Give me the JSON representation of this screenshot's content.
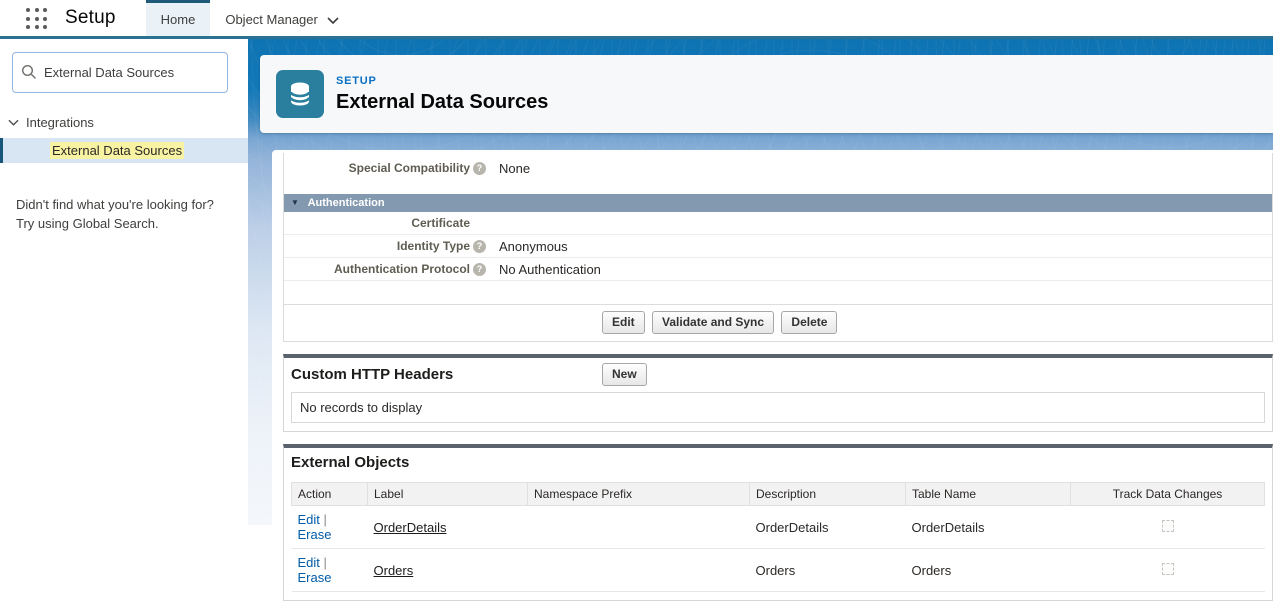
{
  "nav": {
    "app_name": "Setup",
    "tabs": [
      {
        "label": "Home"
      },
      {
        "label": "Object Manager"
      }
    ]
  },
  "sidebar": {
    "search_value": "External Data Sources",
    "tree_section": "Integrations",
    "selected_item": "External Data Sources",
    "not_found_line1": "Didn't find what you're looking for?",
    "not_found_line2": "Try using Global Search."
  },
  "header": {
    "eyebrow": "SETUP",
    "title": "External Data Sources"
  },
  "detail": {
    "special_compatibility_label": "Special Compatibility",
    "special_compatibility_value": "None",
    "auth_section_title": "Authentication",
    "certificate_label": "Certificate",
    "certificate_value": "",
    "identity_type_label": "Identity Type",
    "identity_type_value": "Anonymous",
    "auth_protocol_label": "Authentication Protocol",
    "auth_protocol_value": "No Authentication",
    "buttons": {
      "edit": "Edit",
      "validate": "Validate and Sync",
      "delete": "Delete"
    }
  },
  "custom_http_headers": {
    "title": "Custom HTTP Headers",
    "new_button": "New",
    "empty_text": "No records to display"
  },
  "external_objects": {
    "title": "External Objects",
    "columns": [
      "Action",
      "Label",
      "Namespace Prefix",
      "Description",
      "Table Name",
      "Track Data Changes"
    ],
    "rows": [
      {
        "edit": "Edit",
        "erase": "Erase",
        "label": "OrderDetails",
        "namespace_prefix": "",
        "description": "OrderDetails",
        "table_name": "OrderDetails",
        "track_data_changes": false
      },
      {
        "edit": "Edit",
        "erase": "Erase",
        "label": "Orders",
        "namespace_prefix": "",
        "description": "Orders",
        "table_name": "Orders",
        "track_data_changes": false
      }
    ]
  },
  "colors": {
    "nav_accent": "#2b7192",
    "brand_blue": "#0e73b3",
    "icon_teal": "#2a7f9f",
    "section_header": "#8399af",
    "link": "#015ba7",
    "search_highlight": "#f8f3a2"
  }
}
